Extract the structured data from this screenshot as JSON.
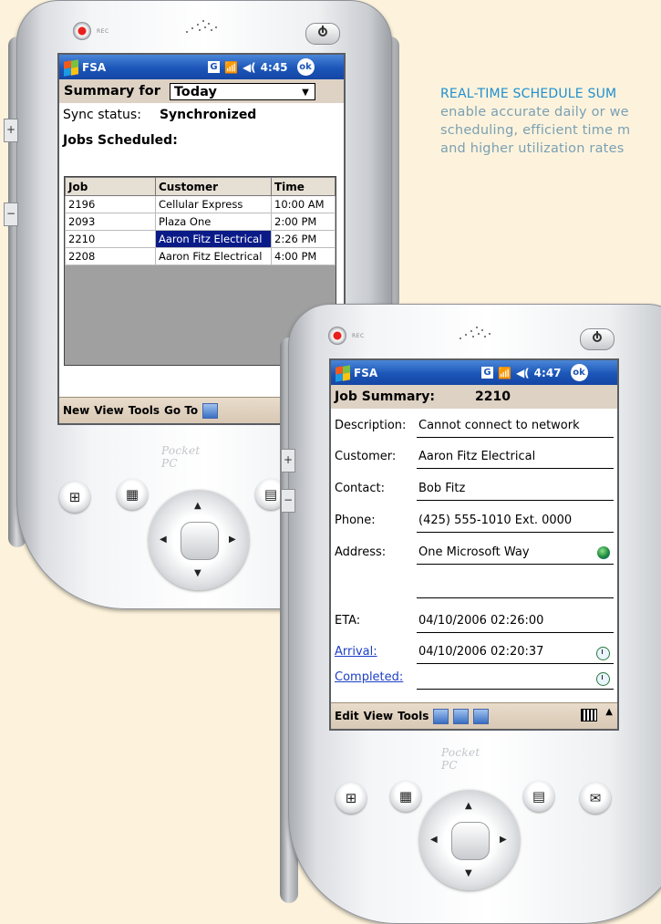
{
  "caption": {
    "heading": "REAL-TIME SCHEDULE SUM",
    "line1": "enable accurate daily or we",
    "line2": "scheduling, efficient time m",
    "line3": "and higher utilization rates"
  },
  "device1": {
    "rec_label": "REC",
    "brand": "Pocket PC",
    "title": "FSA",
    "clock": "4:45",
    "ok_label": "ok",
    "summary_label": "Summary for",
    "summary_value": "Today",
    "sync_label": "Sync status:",
    "sync_value": "Synchronized",
    "jobs_title": "Jobs Scheduled:",
    "columns": [
      "Job",
      "Customer",
      "Time"
    ],
    "rows": [
      [
        "2196",
        "Cellular Express",
        "10:00 AM"
      ],
      [
        "2093",
        "Plaza One",
        "2:00 PM"
      ],
      [
        "2210",
        "Aaron Fitz Electrical",
        "2:26 PM"
      ],
      [
        "2208",
        "Aaron Fitz Electrical",
        "4:00 PM"
      ]
    ],
    "selected_row": 2,
    "menu": [
      "New",
      "View",
      "Tools",
      "Go To"
    ]
  },
  "device2": {
    "rec_label": "REC",
    "brand": "Pocket PC",
    "title": "FSA",
    "clock": "4:47",
    "ok_label": "ok",
    "summary_label": "Job Summary:",
    "job_number": "2210",
    "fields": {
      "description": {
        "label": "Description:",
        "value": "Cannot connect to network"
      },
      "customer": {
        "label": "Customer:",
        "value": "Aaron Fitz Electrical"
      },
      "contact": {
        "label": "Contact:",
        "value": "Bob Fitz"
      },
      "phone": {
        "label": "Phone:",
        "value": "(425) 555-1010 Ext. 0000"
      },
      "address": {
        "label": "Address:",
        "value": "One Microsoft Way",
        "value2": ""
      },
      "eta": {
        "label": "ETA:",
        "value": "04/10/2006 02:26:00"
      },
      "arrival": {
        "label": "Arrival:",
        "value": "04/10/2006 02:20:37"
      },
      "completed": {
        "label": "Completed:",
        "value": ""
      }
    },
    "menu": [
      "Edit",
      "View",
      "Tools"
    ]
  },
  "colors": {
    "background": "#fdf3dc",
    "caption_heading": "#1f8fd0",
    "caption_text": "#7aa0b4",
    "titlebar": "#1b56b8",
    "selection": "#0a1b88",
    "link": "#1d3fc4"
  }
}
